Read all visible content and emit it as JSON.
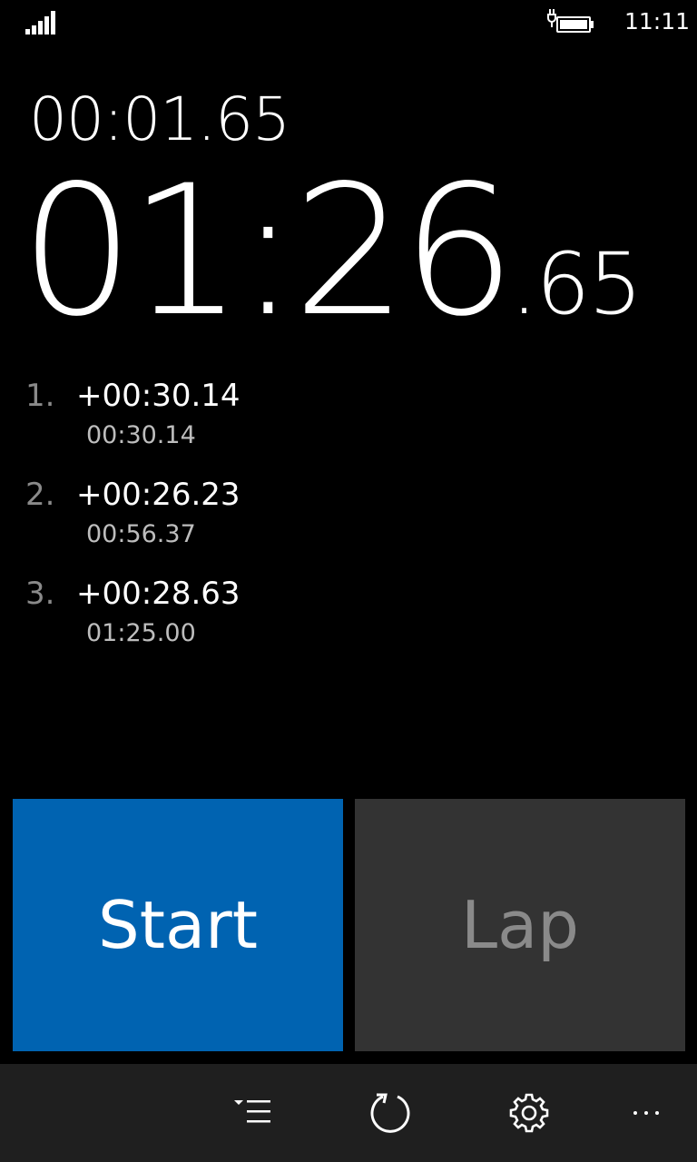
{
  "status_bar": {
    "time": "11:11",
    "icons": [
      "signal-strength-icon",
      "battery-charging-icon"
    ]
  },
  "stopwatch": {
    "lap_time": "00:01.65",
    "total_main": "01:26",
    "total_fraction": ".65"
  },
  "laps": [
    {
      "number": "1.",
      "split": "+00:30.14",
      "total": "00:30.14"
    },
    {
      "number": "2.",
      "split": "+00:26.23",
      "total": "00:56.37"
    },
    {
      "number": "3.",
      "split": "+00:28.63",
      "total": "01:25.00"
    }
  ],
  "buttons": {
    "start_label": "Start",
    "lap_label": "Lap"
  },
  "app_bar": {
    "icons": [
      "lap-list-icon",
      "reset-icon",
      "settings-gear-icon",
      "more-ellipsis-icon"
    ]
  },
  "colors": {
    "background": "#000000",
    "accent": "#0063b1",
    "lap_button": "#333333",
    "app_bar": "#1f1f1f",
    "muted_text": "#8a8a8a"
  }
}
